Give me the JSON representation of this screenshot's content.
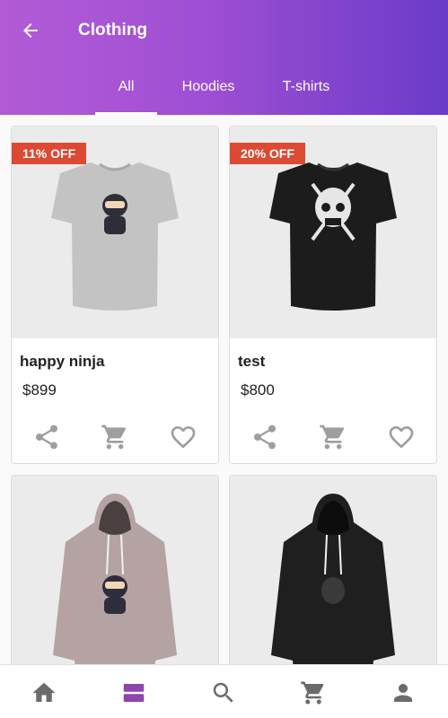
{
  "header": {
    "title": "Clothing",
    "back_icon": "arrow-back-icon"
  },
  "tabs": [
    {
      "label": "All",
      "active": true
    },
    {
      "label": "Hoodies",
      "active": false
    },
    {
      "label": "T-shirts",
      "active": false
    }
  ],
  "products": [
    {
      "name": "happy ninja",
      "price": "$899",
      "badge": "11% OFF",
      "image": "grey-tshirt-ninja"
    },
    {
      "name": "test",
      "price": "$800",
      "badge": "20% OFF",
      "image": "black-tshirt-skull"
    },
    {
      "name": "",
      "price": "",
      "badge": "",
      "image": "grey-hoodie-ninja"
    },
    {
      "name": "",
      "price": "",
      "badge": "",
      "image": "black-hoodie"
    }
  ],
  "card_actions": [
    "share-icon",
    "add-to-cart-icon",
    "heart-icon"
  ],
  "bottom_nav": [
    {
      "icon": "home-icon",
      "active": false
    },
    {
      "icon": "categories-icon",
      "active": true
    },
    {
      "icon": "search-icon",
      "active": false
    },
    {
      "icon": "cart-icon",
      "active": false
    },
    {
      "icon": "account-icon",
      "active": false
    }
  ],
  "colors": {
    "header_start": "#b35bd6",
    "header_end": "#6a3bc8",
    "badge": "#dd4a34",
    "active_nav": "#8e44ad",
    "icon_grey": "#9e9e9e"
  }
}
